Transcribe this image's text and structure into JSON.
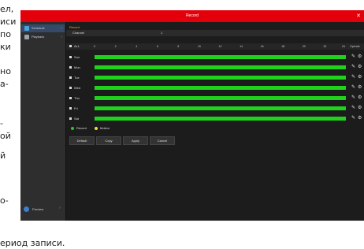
{
  "caption": {
    "lines": [
      "ел,",
      "иси",
      "по",
      "ки",
      "",
      "но",
      "а-",
      "",
      "-",
      "ой",
      "й",
      "",
      "о-"
    ],
    "bottom": "ериод записи."
  },
  "window": {
    "title": "Record"
  },
  "sidebar": {
    "items": [
      {
        "label": "Schedule",
        "icon": "record-icon",
        "active": true
      },
      {
        "label": "Playback",
        "icon": "playback-icon",
        "active": false
      }
    ]
  },
  "status": {
    "label": "Preview"
  },
  "content": {
    "section_title": "Record",
    "channel_label": "Channel",
    "channel_value": "1",
    "all_label": "ALL",
    "hours": [
      "0",
      "2",
      "4",
      "6",
      "8",
      "10",
      "12",
      "14",
      "16",
      "18",
      "20",
      "22",
      "24"
    ],
    "operate_label": "Operate",
    "days": [
      "Sun",
      "Mon",
      "Tue",
      "Wed",
      "Thu",
      "Fri",
      "Sat"
    ]
  },
  "legend": {
    "items": [
      {
        "label": "Record",
        "color": "#20d21c"
      },
      {
        "label": "Motion",
        "color": "#f0e020"
      }
    ]
  },
  "buttons": [
    "Default",
    "Copy",
    "Apply",
    "Cancel"
  ],
  "colors": {
    "accent": "#e3000b",
    "schedule": "#20d21c",
    "section": "#f2a83a"
  }
}
